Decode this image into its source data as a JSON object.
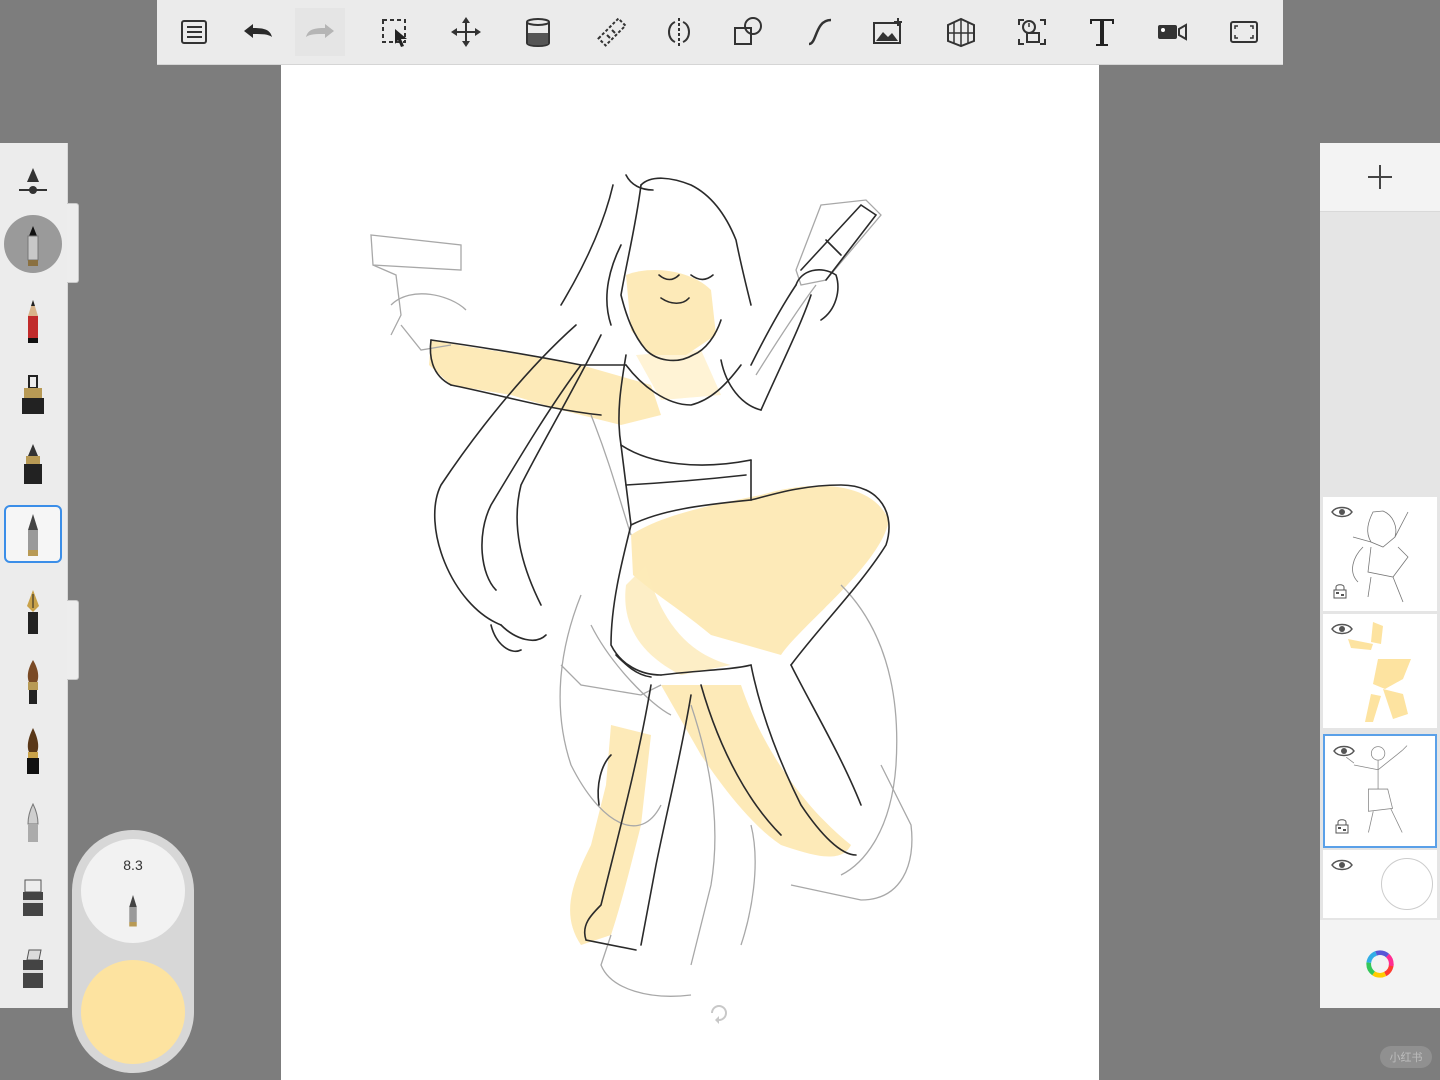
{
  "toolbar": {
    "items": [
      "list-icon",
      "undo-icon",
      "redo-icon",
      "selection-icon",
      "transform-icon",
      "fill-icon",
      "ruler-icon",
      "symmetry-icon",
      "shape-icon",
      "curve-icon",
      "image-icon",
      "perspective-icon",
      "timelapse-icon",
      "text-icon",
      "record-icon",
      "fullscreen-icon"
    ]
  },
  "brushes": [
    "brush-size-opacity",
    "airbrush",
    "pencil",
    "marker",
    "ink-pen",
    "ballpoint-pen",
    "fountain-pen",
    "paintbrush",
    "calligraphy-brush",
    "blender",
    "eraser",
    "smudge"
  ],
  "puck": {
    "size_value": "8.3",
    "color": "#fde3a0"
  },
  "layers": [
    {
      "name": "lineart-layer",
      "visible": true,
      "locked": true
    },
    {
      "name": "color-layer",
      "visible": true,
      "locked": false
    },
    {
      "name": "sketch-layer",
      "visible": true,
      "locked": true,
      "selected": true
    },
    {
      "name": "background-layer",
      "visible": true,
      "locked": false
    }
  ],
  "colors": {
    "accent": "#3b8ee8",
    "skin": "#fde3a0",
    "toolbar_bg": "#ebebeb",
    "workspace": "#7d7d7d"
  },
  "watermark": "小红书"
}
